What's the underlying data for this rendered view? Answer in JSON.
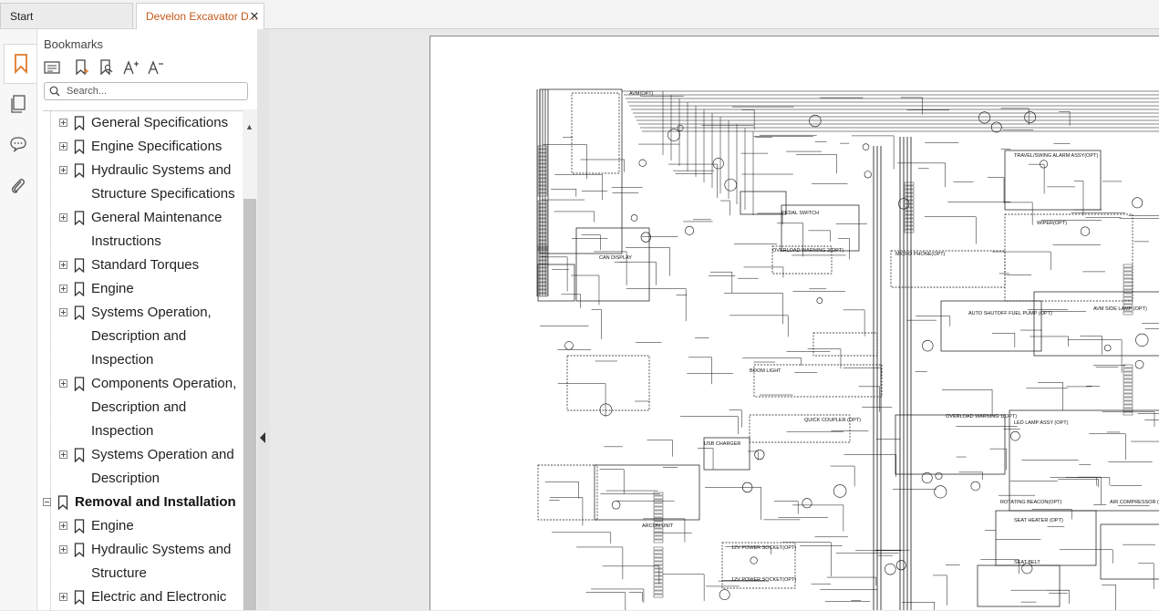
{
  "tabs": [
    {
      "label": "Start",
      "active": false
    },
    {
      "label": "Develon Excavator D...",
      "active": true,
      "close": "✕"
    }
  ],
  "rail_icons": [
    "bookmark-icon",
    "pages-icon",
    "comment-icon",
    "attachment-icon"
  ],
  "panel": {
    "title": "Bookmarks",
    "toolbar_icons": [
      "list-options-icon",
      "new-bookmark-icon",
      "find-bookmark-icon",
      "text-larger-icon",
      "text-smaller-icon"
    ],
    "search_placeholder": "Search..."
  },
  "bookmarks": [
    {
      "label": "General Specifications",
      "level": 2,
      "expander": "plus"
    },
    {
      "label": "Engine Specifications",
      "level": 2,
      "expander": "plus"
    },
    {
      "label": "Hydraulic Systems and",
      "level": 2,
      "expander": "plus"
    },
    {
      "label": "Structure Specifications",
      "level": 2,
      "continuation": true
    },
    {
      "label": "General Maintenance",
      "level": 2,
      "expander": "plus"
    },
    {
      "label": "Instructions",
      "level": 2,
      "continuation": true
    },
    {
      "label": "Standard Torques",
      "level": 2,
      "expander": "plus"
    },
    {
      "label": "Engine",
      "level": 2,
      "expander": "plus"
    },
    {
      "label": "Systems Operation,",
      "level": 2,
      "expander": "plus"
    },
    {
      "label": "Description and",
      "level": 2,
      "continuation": true
    },
    {
      "label": "Inspection",
      "level": 2,
      "continuation": true
    },
    {
      "label": "Components Operation,",
      "level": 2,
      "expander": "plus"
    },
    {
      "label": "Description and",
      "level": 2,
      "continuation": true
    },
    {
      "label": "Inspection",
      "level": 2,
      "continuation": true
    },
    {
      "label": "Systems Operation and",
      "level": 2,
      "expander": "plus"
    },
    {
      "label": "Description",
      "level": 2,
      "continuation": true
    },
    {
      "label": "Removal and Installation",
      "level": 1,
      "expander": "minus",
      "bold": true
    },
    {
      "label": "Engine",
      "level": 2,
      "expander": "plus"
    },
    {
      "label": "Hydraulic Systems and",
      "level": 2,
      "expander": "plus"
    },
    {
      "label": "Structure",
      "level": 2,
      "continuation": true
    },
    {
      "label": "Electric and Electronic",
      "level": 2,
      "expander": "plus"
    }
  ],
  "colors": {
    "active_tab_text": "#c4581a",
    "bookmark_selected": "#e07a2a"
  },
  "schematic": {
    "labels": [
      "AVM(OPT)",
      "TRAVEL/SWING ALARM ASSY(OPT)",
      "WIPER(OPT)",
      "OVERLOAD WARNING 2(OPT)",
      "MICRO PHONE(OPT)",
      "AUTO SHUTOFF FUEL PUMP (OPT)",
      "AVM SIDE LAMP (OPT)",
      "OVERLOAD WARNING 1(OPT)",
      "USB CHARGER",
      "QUICK COUPLER (OPT)",
      "ROTATING BEACON(OPT)",
      "SEAT HEATER (OPT)",
      "SEAT BELT",
      "AIR COMPRESSOR (OPT)",
      "12V POWER SOCKET(OPT)",
      "12V POWER SOCKET(OPT)",
      "LED LAMP ASSY (OPT)",
      "CAN DISPLAY",
      "BOOM LIGHT",
      "ARCON UNIT",
      "PEDAL SWITCH"
    ]
  }
}
